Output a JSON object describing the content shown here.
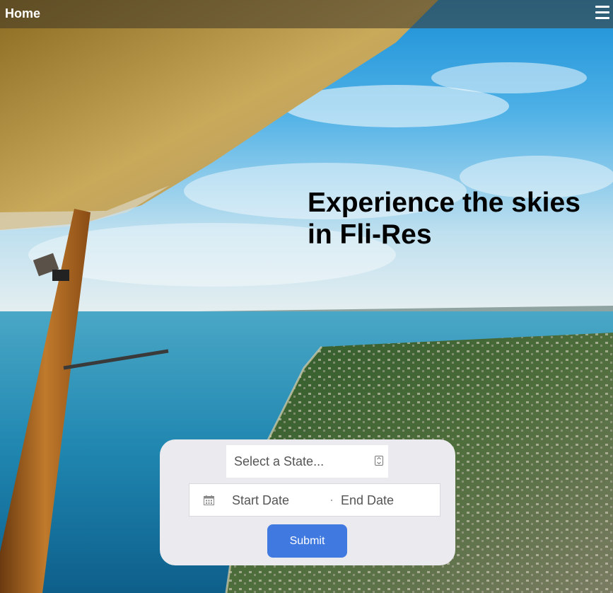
{
  "navbar": {
    "home_label": "Home"
  },
  "hero": {
    "headline": "Experience the skies in Fli-Res"
  },
  "search_form": {
    "state_placeholder": "Select a State...",
    "start_date_placeholder": "Start Date",
    "end_date_placeholder": "End Date",
    "submit_label": "Submit"
  },
  "icons": {
    "menu": "hamburger-menu-icon",
    "state_select": "select-dropdown-icon",
    "date": "calendar-icon"
  },
  "colors": {
    "navbar_overlay": "#3c3428",
    "submit_button": "#4079df",
    "form_card": "#eaeaef"
  }
}
